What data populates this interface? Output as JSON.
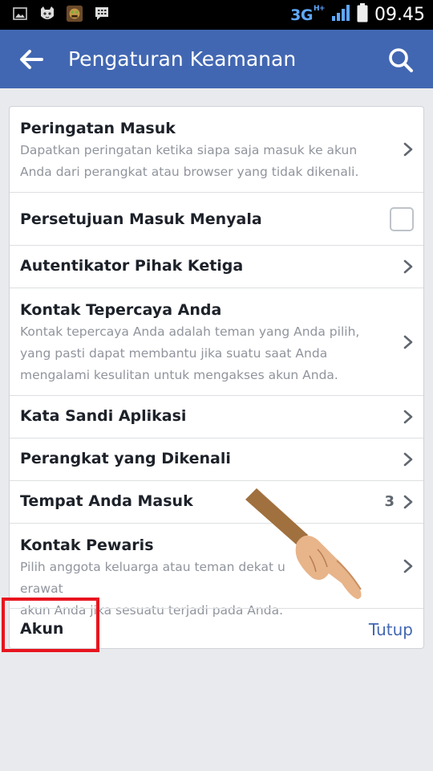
{
  "status_bar": {
    "network": "3G",
    "network_sup": "H+",
    "time": "09.45",
    "icons": [
      "gallery-icon",
      "cat-app-icon",
      "game-app-icon",
      "bbm-icon",
      "signal-icon",
      "battery-icon"
    ]
  },
  "app_bar": {
    "title": "Pengaturan Keamanan",
    "back_icon": "arrow-left-icon",
    "search_icon": "search-icon",
    "color": "#4267b2"
  },
  "settings": {
    "login_alerts": {
      "title": "Peringatan Masuk",
      "description": "Dapatkan peringatan ketika siapa saja masuk ke akun Anda dari perangkat atau browser yang tidak dikenali."
    },
    "login_approvals": {
      "title": "Persetujuan Masuk Menyala",
      "checked": false
    },
    "third_party_auth": {
      "title": "Autentikator Pihak Ketiga"
    },
    "trusted_contacts": {
      "title": "Kontak Tepercaya Anda",
      "description": "Kontak tepercaya Anda adalah teman yang Anda pilih, yang pasti dapat membantu jika suatu saat Anda mengalami kesulitan untuk mengakses akun Anda."
    },
    "app_passwords": {
      "title": "Kata Sandi Aplikasi"
    },
    "recognized_devices": {
      "title": "Perangkat yang Dikenali"
    },
    "where_logged_in": {
      "title": "Tempat Anda Masuk",
      "count": "3"
    },
    "legacy_contact": {
      "title": "Kontak Pewaris",
      "description_part1": "Pilih anggota keluarga atau teman dekat u",
      "description_part2": "erawat",
      "description_line2": "akun Anda jika sesuatu terjadi pada Anda."
    },
    "account": {
      "title": "Akun",
      "close_label": "Tutup"
    }
  },
  "annotation": {
    "highlight_color": "#e8141e"
  }
}
